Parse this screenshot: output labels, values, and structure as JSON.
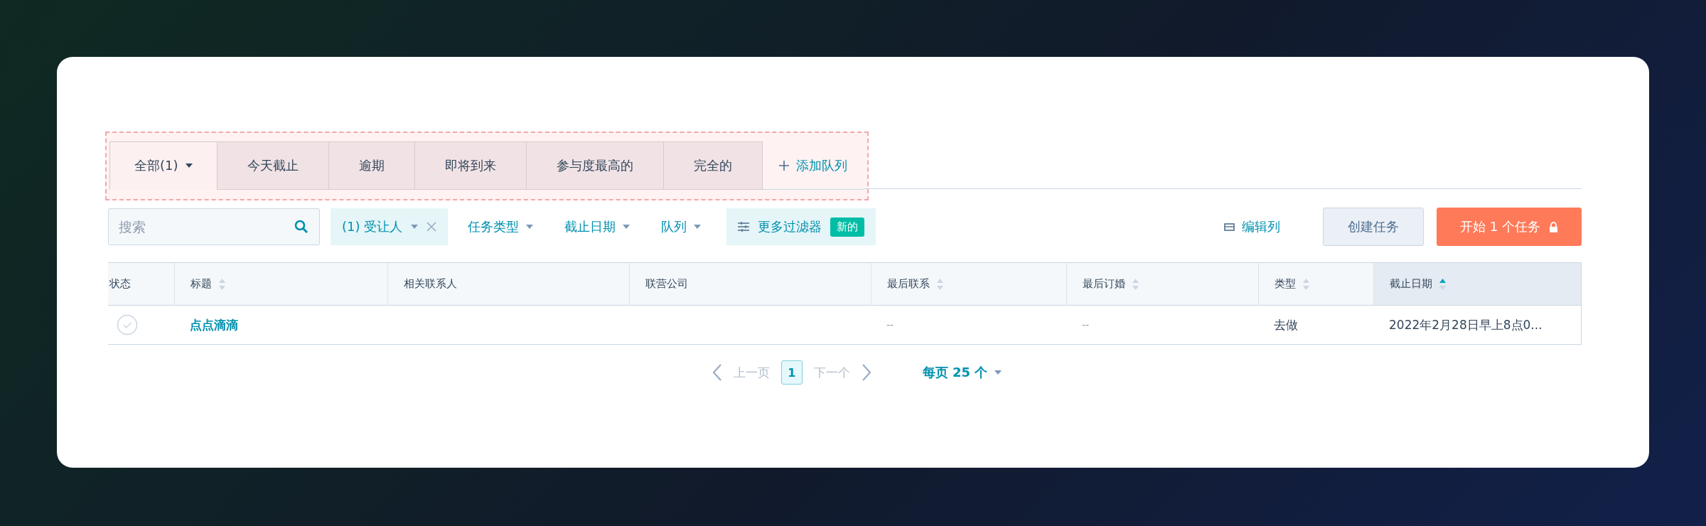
{
  "tabs": [
    {
      "label": "全部(1)",
      "selected": true,
      "dropdown": true
    },
    {
      "label": "今天截止",
      "selected": false,
      "dropdown": false
    },
    {
      "label": "逾期",
      "selected": false,
      "dropdown": false
    },
    {
      "label": "即将到来",
      "selected": false,
      "dropdown": false
    },
    {
      "label": "参与度最高的",
      "selected": false,
      "dropdown": false
    },
    {
      "label": "完全的",
      "selected": false,
      "dropdown": false
    }
  ],
  "add_tab": {
    "label": "添加队列"
  },
  "search": {
    "placeholder": "搜索"
  },
  "filters": [
    {
      "kind": "chip",
      "label": "(1) 受让人",
      "removable": true
    },
    {
      "kind": "dropdown",
      "label": "任务类型"
    },
    {
      "kind": "dropdown",
      "label": "截止日期"
    },
    {
      "kind": "dropdown",
      "label": "队列"
    },
    {
      "kind": "more",
      "label": "更多过滤器",
      "badge": "新的"
    }
  ],
  "edit_columns": {
    "label": "编辑列"
  },
  "buttons": [
    {
      "kind": "secondary",
      "label": "创建任务"
    },
    {
      "kind": "primary",
      "label": "开始 1 个任务",
      "locked": true
    }
  ],
  "table": {
    "columns": [
      {
        "label": "状态",
        "sortable": false,
        "sorted": false
      },
      {
        "label": "标题",
        "sortable": true,
        "sorted": false
      },
      {
        "label": "相关联系人",
        "sortable": false,
        "sorted": false
      },
      {
        "label": "联营公司",
        "sortable": false,
        "sorted": false
      },
      {
        "label": "最后联系",
        "sortable": true,
        "sorted": false
      },
      {
        "label": "最后订婚",
        "sortable": true,
        "sorted": false
      },
      {
        "label": "类型",
        "sortable": true,
        "sorted": false
      },
      {
        "label": "截止日期",
        "sortable": true,
        "sorted": true
      }
    ],
    "rows": [
      {
        "checked": false,
        "cells": [
          null,
          "点点滴滴",
          null,
          null,
          "--",
          "--",
          "去做",
          "2022年2月28日早上8点0..."
        ]
      }
    ]
  },
  "pagination": {
    "prev": "上一页",
    "pages": [
      {
        "label": "1",
        "selected": true
      }
    ],
    "next": "下一个",
    "per_page": "每页 25 个"
  }
}
